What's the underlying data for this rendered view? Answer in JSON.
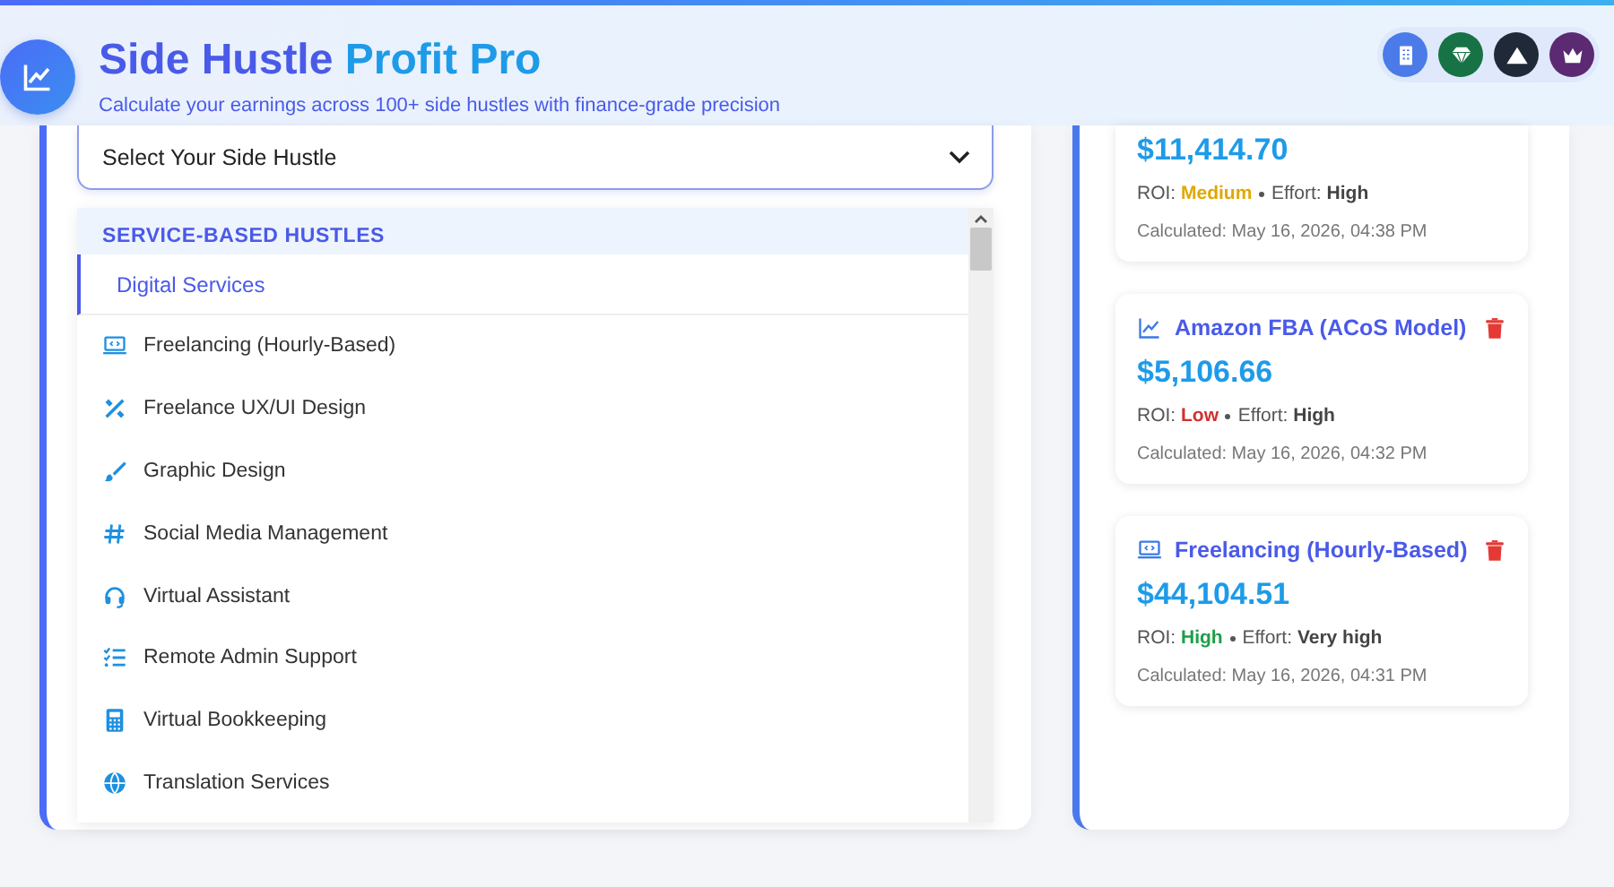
{
  "header": {
    "title_main": "Side Hustle",
    "title_accent": "Profit Pro",
    "subtitle": "Calculate your earnings across 100+ side hustles with finance-grade precision",
    "badges": [
      {
        "kind": "building",
        "color": "#4a7be8"
      },
      {
        "kind": "gem",
        "color": "#177245"
      },
      {
        "kind": "mountain",
        "color": "#1f2937"
      },
      {
        "kind": "crown",
        "color": "#5b2a72"
      }
    ]
  },
  "select": {
    "placeholder": "Select Your Side Hustle"
  },
  "dropdown": {
    "group": "SERVICE-BASED HUSTLES",
    "subgroup": "Digital Services",
    "items": [
      {
        "label": "Freelancing (Hourly-Based)"
      },
      {
        "label": "Freelance UX/UI Design"
      },
      {
        "label": "Graphic Design"
      },
      {
        "label": "Social Media Management"
      },
      {
        "label": "Virtual Assistant"
      },
      {
        "label": "Remote Admin Support"
      },
      {
        "label": "Virtual Bookkeeping"
      },
      {
        "label": "Translation Services"
      }
    ]
  },
  "results": [
    {
      "amount": "$11,414.70",
      "roi_label": "ROI:",
      "roi": {
        "text": "Medium",
        "color": "#e0a800"
      },
      "effort_label": "Effort:",
      "effort": "High",
      "calculated": "Calculated: May 16, 2026, 04:38 PM"
    },
    {
      "title": "Amazon FBA (ACoS Model)",
      "amount": "$5,106.66",
      "roi_label": "ROI:",
      "roi": {
        "text": "Low",
        "color": "#d32f2f"
      },
      "effort_label": "Effort:",
      "effort": "High",
      "calculated": "Calculated: May 16, 2026, 04:32 PM"
    },
    {
      "title": "Freelancing (Hourly-Based)",
      "amount": "$44,104.51",
      "roi_label": "ROI:",
      "roi": {
        "text": "High",
        "color": "#1e9e4a"
      },
      "effort_label": "Effort:",
      "effort": "Very high",
      "calculated": "Calculated: May 16, 2026, 04:31 PM"
    }
  ]
}
